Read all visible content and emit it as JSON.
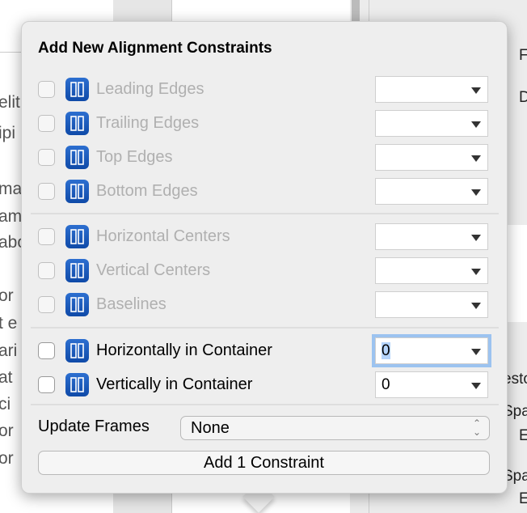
{
  "background": {
    "left_fragments": [
      "elit",
      "ipi",
      "ma",
      "am",
      "abo",
      "or",
      "t e",
      "ari",
      "at",
      "ci",
      "or",
      "or"
    ],
    "right_fragments": [
      "F",
      "D",
      "esto",
      "Spa",
      "E",
      "Spa",
      "E"
    ]
  },
  "popover": {
    "title": "Add New Alignment Constraints",
    "groups": [
      [
        {
          "label": "Leading Edges",
          "icon": "leading-edges-icon",
          "checked": false,
          "enabled": false,
          "value": ""
        },
        {
          "label": "Trailing Edges",
          "icon": "trailing-edges-icon",
          "checked": false,
          "enabled": false,
          "value": ""
        },
        {
          "label": "Top Edges",
          "icon": "top-edges-icon",
          "checked": false,
          "enabled": false,
          "value": ""
        },
        {
          "label": "Bottom Edges",
          "icon": "bottom-edges-icon",
          "checked": false,
          "enabled": false,
          "value": ""
        }
      ],
      [
        {
          "label": "Horizontal Centers",
          "icon": "horizontal-centers-icon",
          "checked": false,
          "enabled": false,
          "value": ""
        },
        {
          "label": "Vertical Centers",
          "icon": "vertical-centers-icon",
          "checked": false,
          "enabled": false,
          "value": ""
        },
        {
          "label": "Baselines",
          "icon": "baselines-icon",
          "checked": false,
          "enabled": false,
          "value": ""
        }
      ],
      [
        {
          "label": "Horizontally in Container",
          "icon": "horizontal-center-container-icon",
          "checked": true,
          "enabled": true,
          "value": "0"
        },
        {
          "label": "Vertically in Container",
          "icon": "vertical-center-container-icon",
          "checked": false,
          "enabled": true,
          "value": "0"
        }
      ]
    ],
    "update_frames_label": "Update Frames",
    "update_frames_value": "None",
    "add_button": "Add 1 Constraint",
    "accent": "#3b8ef0"
  }
}
